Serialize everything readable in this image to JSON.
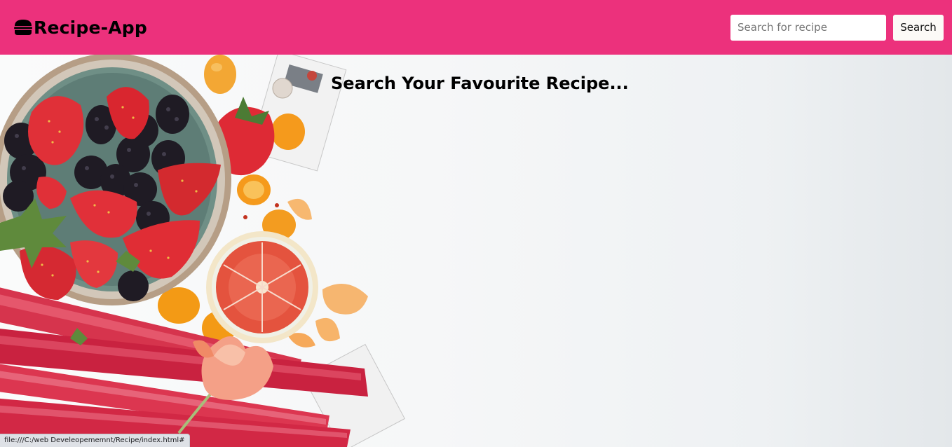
{
  "navbar": {
    "brand_icon": "burger-icon",
    "brand_text": "Recipe-App",
    "background_color": "#ec317c"
  },
  "search": {
    "placeholder": "Search for recipe",
    "value": "",
    "button_label": "Search"
  },
  "hero": {
    "heading": "Search Your Favourite Recipe...",
    "background_image": "fruit-bowl-strawberries-blackberries-rhubarb-grapefruit-photo"
  },
  "status_bar": {
    "url": "file:///C:/web Develeopememnt/Recipe/index.html#"
  }
}
